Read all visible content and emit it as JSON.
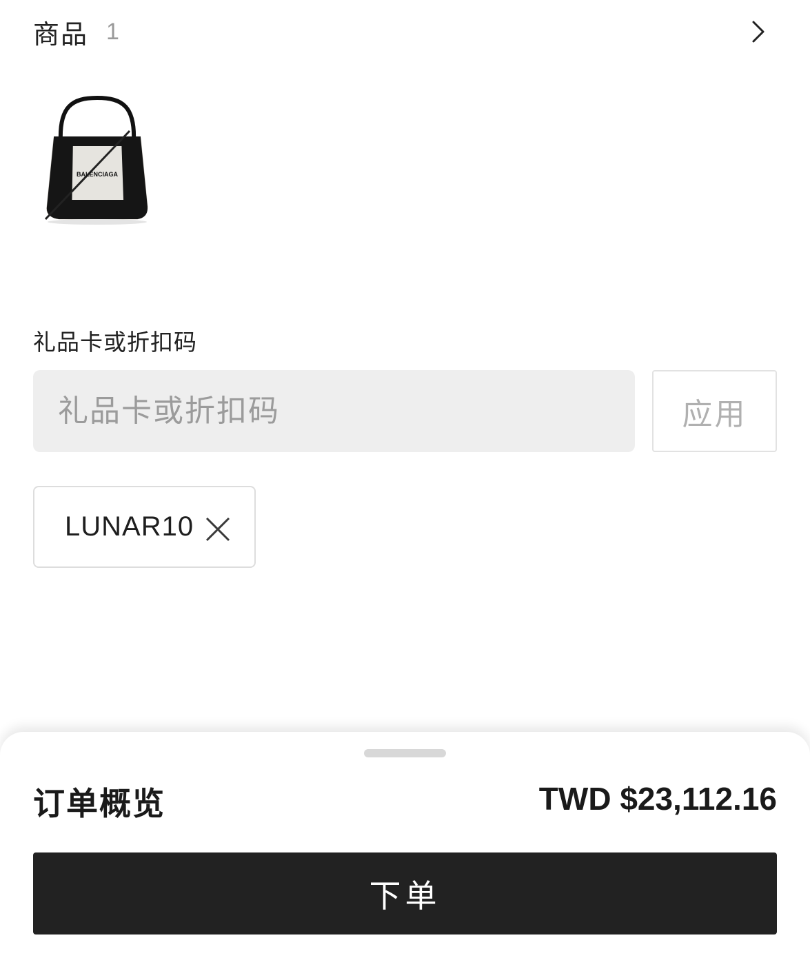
{
  "items": {
    "title": "商品",
    "count": "1",
    "expand_icon": "chevron-right-icon"
  },
  "product": {
    "thumbnail_icon": "handbag-image",
    "brand_print": "BALENCIAGA"
  },
  "gift_card": {
    "label": "礼品卡或折扣码",
    "placeholder": "礼品卡或折扣码",
    "value": "",
    "apply_label": "应用"
  },
  "applied_code": {
    "code": "LUNAR10",
    "remove_icon": "close-icon"
  },
  "order_summary": {
    "title": "订单概览",
    "total": "TWD $23,112.16",
    "place_order_label": "下单"
  },
  "colors": {
    "primary_button": "#222222",
    "input_background": "#eeeeee",
    "muted_text": "#9b9b9b"
  }
}
